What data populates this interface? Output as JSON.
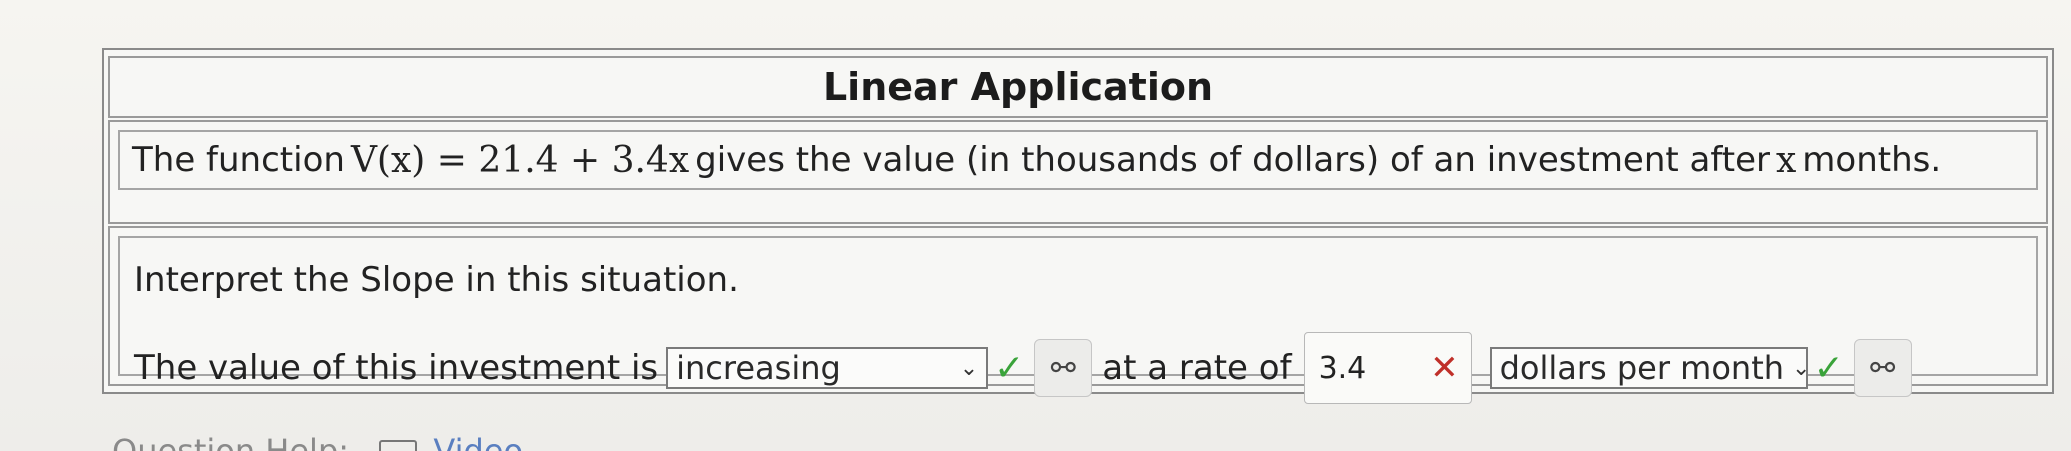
{
  "problem": {
    "title": "Linear Application",
    "function_prefix": "The function",
    "function_math": "V(x) = 21.4 + 3.4x",
    "function_suffix": "gives the value (in thousands of dollars) of an investment after",
    "function_var": "x",
    "function_end": "months.",
    "question": "Interpret the Slope in this situation."
  },
  "answer": {
    "prefix": "The value of this investment is",
    "select1": {
      "selected": "increasing",
      "status": "correct"
    },
    "middle": "at a rate of",
    "input_value": "3.4",
    "input_status": "incorrect",
    "select2": {
      "selected": "dollars per month",
      "status": "correct"
    },
    "check_glyph": "✓",
    "x_glyph": "✕",
    "help_glyph": "⚯",
    "chevron_glyph": "⌄"
  },
  "footer": {
    "question_help_label": "Question Help:",
    "video_label": "Video"
  },
  "colors": {
    "correct": "#3aa33a",
    "incorrect": "#c0302a",
    "link": "#5a7fc0"
  }
}
